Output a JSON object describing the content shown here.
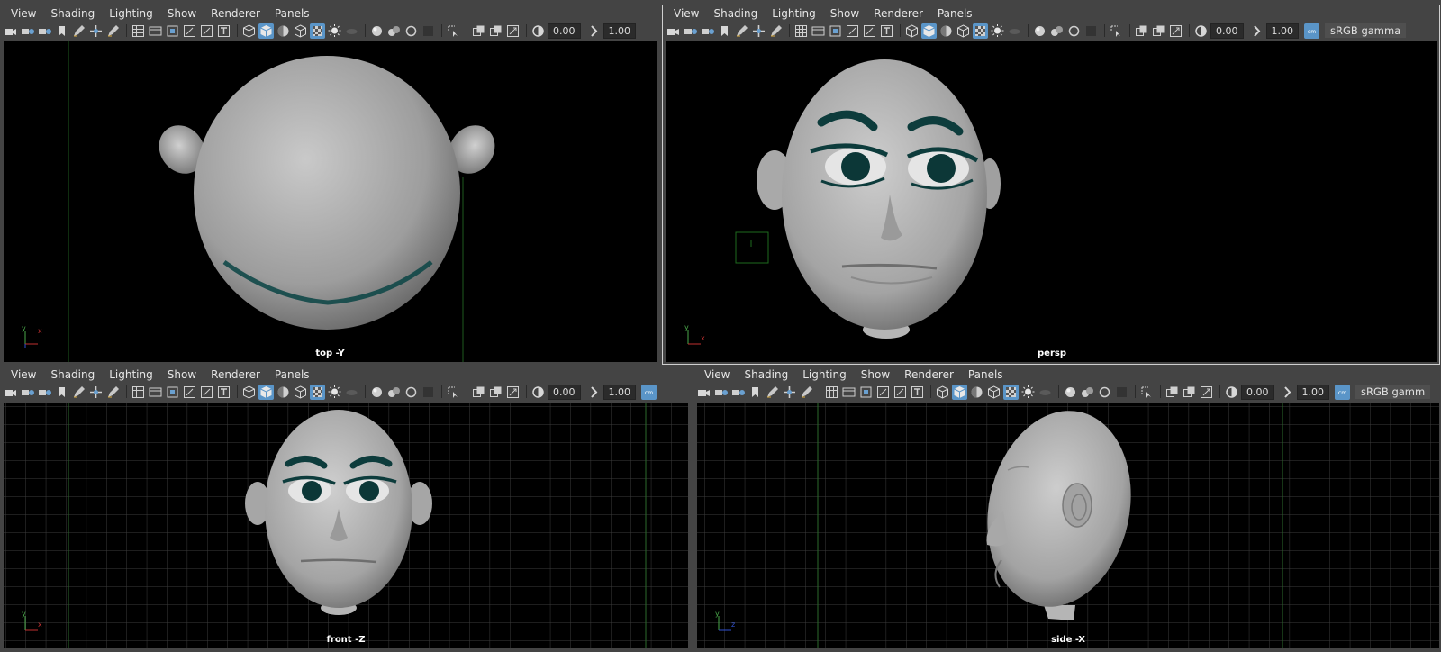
{
  "menu": [
    "View",
    "Shading",
    "Lighting",
    "Show",
    "Renderer",
    "Panels"
  ],
  "toolbar": {
    "exposure": "0.00",
    "gamma": "1.00",
    "color_space": "sRGB gamma"
  },
  "panels": {
    "top": {
      "camera": "top -Y",
      "toolbar_truncated_gamma": "1.00"
    },
    "persp": {
      "camera": "persp"
    },
    "front": {
      "camera": "front -Z"
    },
    "side": {
      "camera": "side -X",
      "color_space_truncated": "sRGB gamm"
    }
  },
  "colors": {
    "viewport_bg": "#000000",
    "ui_bg": "#444444",
    "highlight": "#5a95c8",
    "grid": "#3c3c3c",
    "skin": "#b9b9b9",
    "eye_accent": "#0e3f3f"
  },
  "icons": [
    "camera-icon",
    "bookmark-icon",
    "wireframe-icon",
    "smooth-shade-icon",
    "light-icon",
    "xray-icon",
    "isolate-icon",
    "exposure-icon",
    "gamma-icon",
    "colorspace-icon"
  ]
}
